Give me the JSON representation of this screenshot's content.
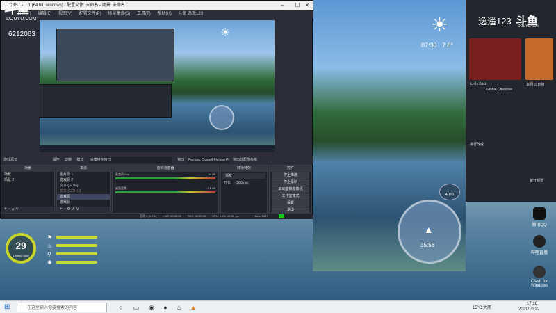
{
  "douyu": {
    "logo": "斗鱼",
    "sub": "DOUYU.COM",
    "room_id": "6212063"
  },
  "obs": {
    "title": "OBS 27.1.1 (64 bit, windows) - 配置文件: 未命名 - 场景: 未命名",
    "menu": [
      "文件(F)",
      "编辑(E)",
      "视图(V)",
      "配置文件(P)",
      "场景集合(S)",
      "工具(T)",
      "帮助(H)",
      "斗鱼 逸遥123"
    ],
    "toolbar": {
      "scene_label": "游戏源 2",
      "properties": "属性",
      "filters": "滤镜",
      "mode": "模式",
      "capture": "采集特定窗口",
      "window_label": "窗口",
      "window_value": "[Fantasy Ocean] Fishing Planet.exe",
      "priority": "窗口匹配优先级"
    },
    "scenes": {
      "header": "场景",
      "items": [
        "场景",
        "场景 2"
      ]
    },
    "sources": {
      "header": "来源",
      "items": [
        "图片源 1",
        "游戏源 2",
        "文本 (GDI+)",
        "文本 (GDI+) 2",
        "游戏源",
        "游戏源"
      ]
    },
    "mixer": {
      "header": "音频混音器",
      "rows": [
        {
          "name": "麦克风/Aux",
          "db": "-inf dB"
        },
        {
          "name": "桌面音频",
          "db": "-7.8 dB"
        }
      ]
    },
    "transitions": {
      "header": "转场特效",
      "type": "渐变",
      "duration_label": "时长",
      "duration": "300 ms"
    },
    "controls": {
      "header": "控件",
      "buttons": [
        "停止推流",
        "停止录制",
        "启动虚拟摄像机",
        "工作室模式",
        "设置",
        "退出"
      ]
    },
    "status": {
      "dropped": "丢帧 0 (0.0%)",
      "live": "LIVE: 00:00:00",
      "rec": "REC: 00:00:00",
      "cpu": "CPU: 1.6%, 60.00 fps",
      "bitrate": "kb/s: 1027"
    }
  },
  "game": {
    "time": "07:30",
    "temp": "7.8°",
    "compass_time": "35:58",
    "fish_count": "4/100",
    "level": "29",
    "xp": "1.98M/2.05M"
  },
  "side": {
    "title": "逸遥123",
    "logo": "斗鱼",
    "sub": "DOUYU.COM",
    "card_text_1": "Ice Is Back",
    "card_text_2": "Global Offensive",
    "card_text_3": "10月19日特",
    "section": "排行改成",
    "note": "新开频道"
  },
  "desktop_icons": [
    "腾讯QQ",
    "哔哩直播",
    "Clash for Windows"
  ],
  "taskbar": {
    "search_placeholder": "在这里输入你要搜索的内容",
    "weather": "15°C 大雨",
    "time": "17:18",
    "date": "2021/10/22"
  },
  "colors": {
    "obs_bg": "#2b2e38",
    "hud_accent": "#c9d42a",
    "status_green": "#1ec81e"
  }
}
